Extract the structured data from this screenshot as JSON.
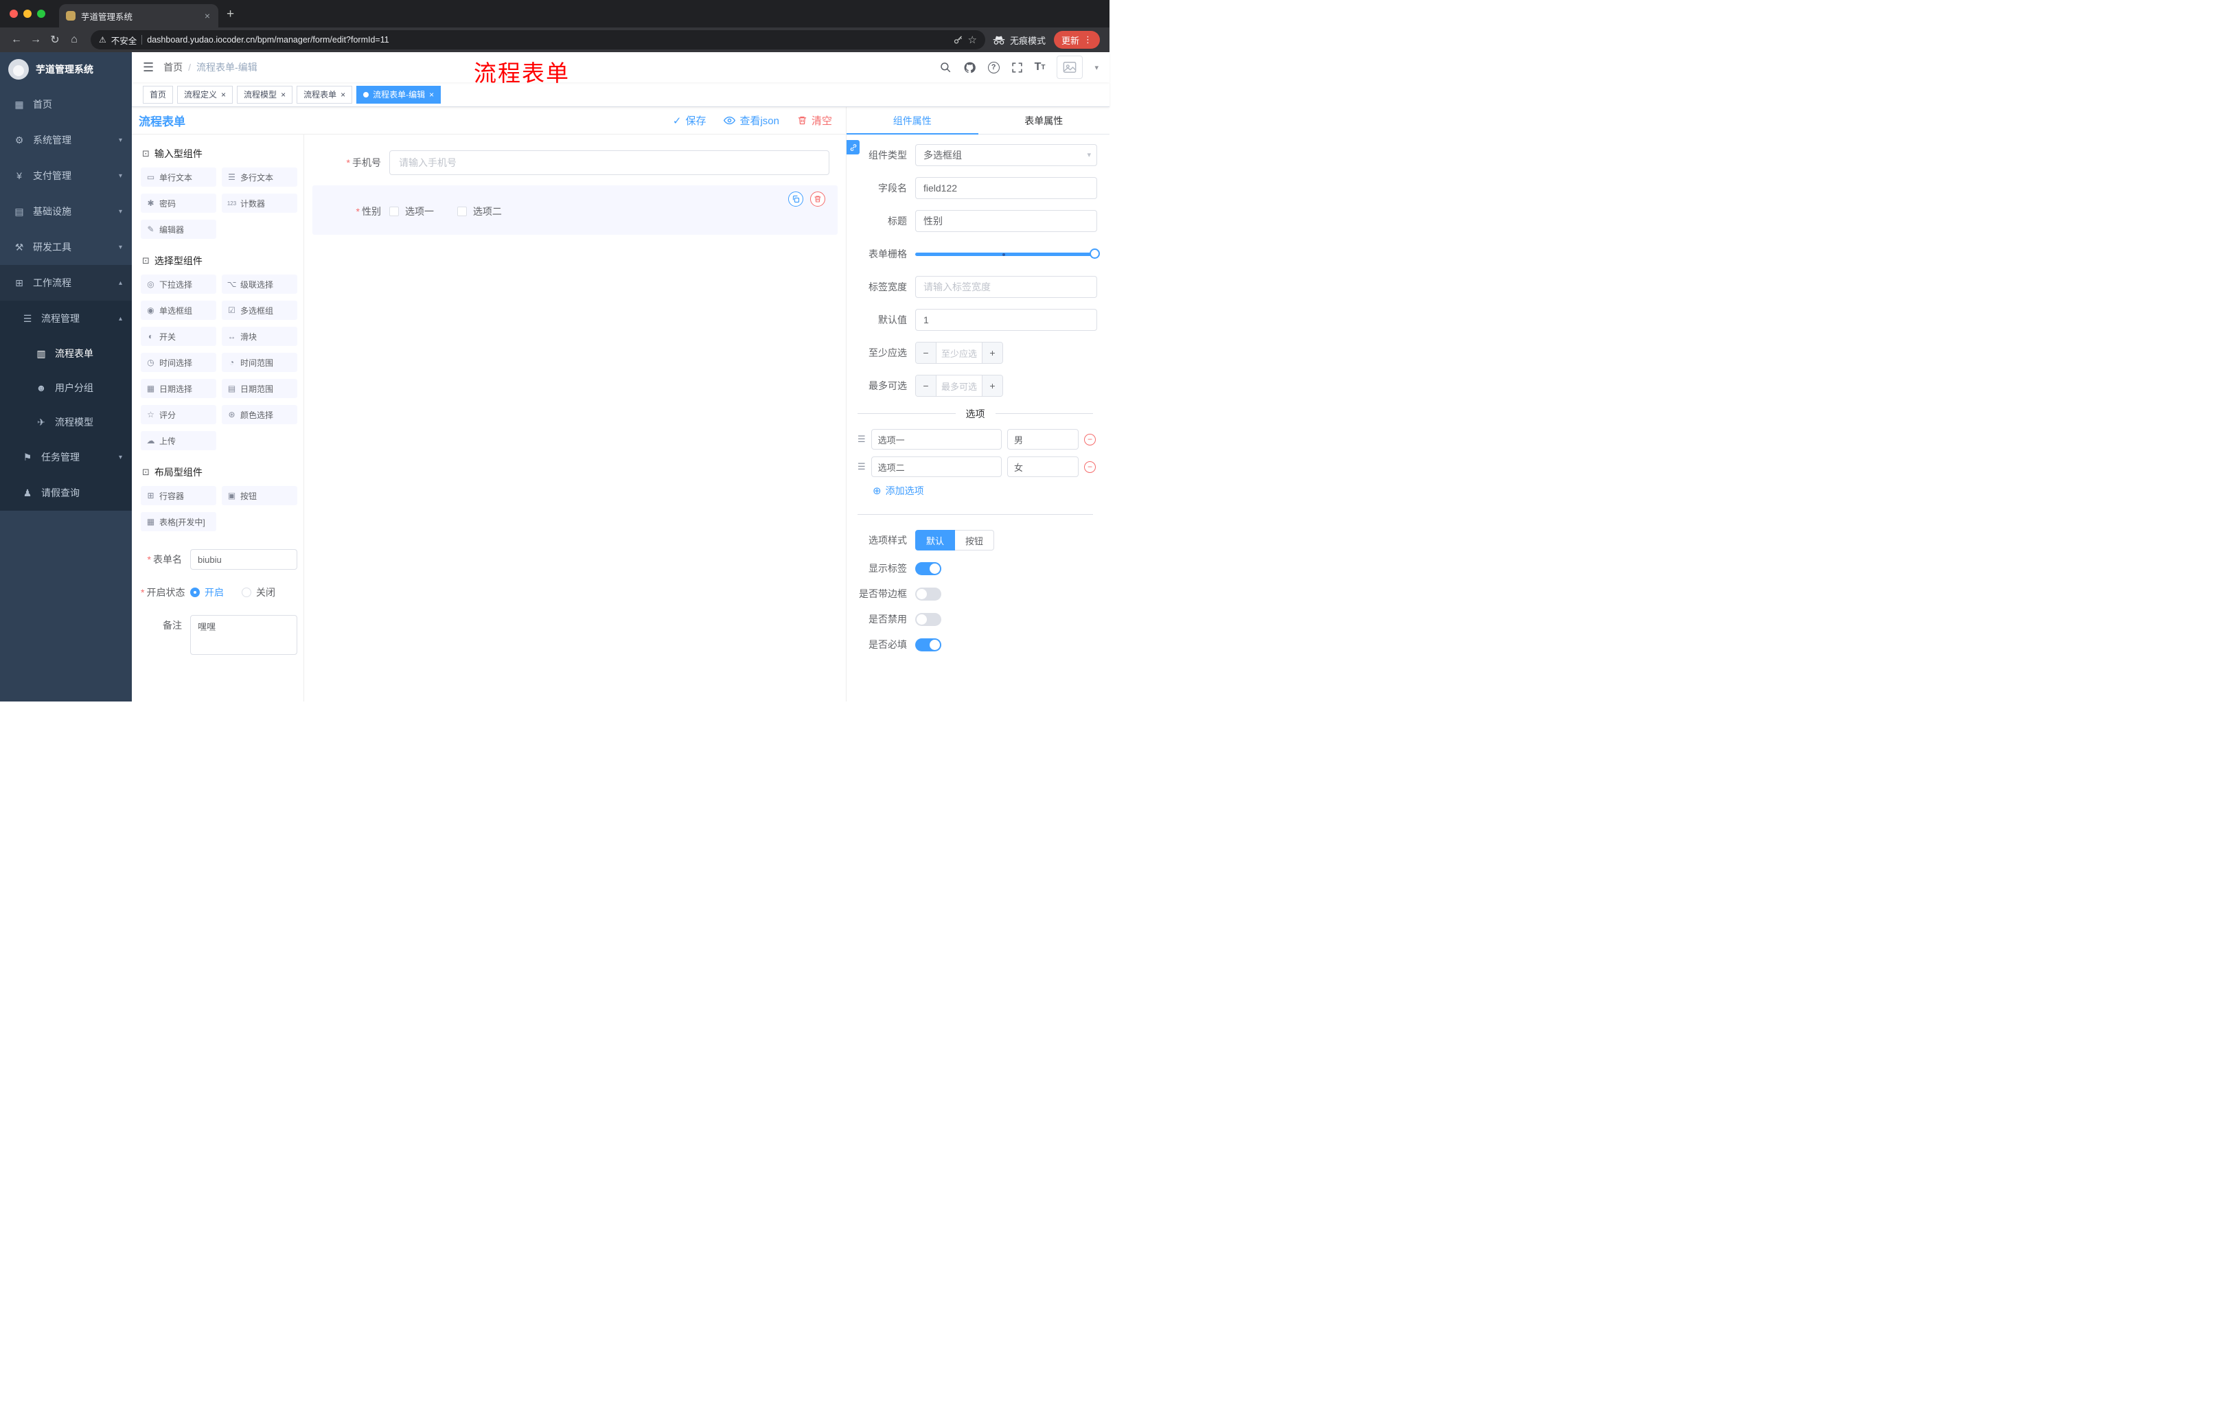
{
  "browser": {
    "tab_title": "芋道管理系统",
    "security_label": "不安全",
    "url": "dashboard.yudao.iocoder.cn/bpm/manager/form/edit?formId=11",
    "incognito_label": "无痕模式",
    "update_label": "更新"
  },
  "sidebar": {
    "logo_title": "芋道管理系统",
    "items": [
      {
        "label": "首页",
        "icon": "dashboard-icon"
      },
      {
        "label": "系统管理",
        "icon": "gear-icon"
      },
      {
        "label": "支付管理",
        "icon": "yen-icon"
      },
      {
        "label": "基础设施",
        "icon": "infrastructure-icon"
      },
      {
        "label": "研发工具",
        "icon": "tools-icon"
      },
      {
        "label": "工作流程",
        "icon": "workflow-icon"
      },
      {
        "label": "流程管理",
        "icon": "process-list-icon"
      },
      {
        "label": "流程表单",
        "icon": "form-doc-icon"
      },
      {
        "label": "用户分组",
        "icon": "user-group-icon"
      },
      {
        "label": "流程模型",
        "icon": "paper-plane-icon"
      },
      {
        "label": "任务管理",
        "icon": "flag-icon"
      },
      {
        "label": "请假查询",
        "icon": "person-icon"
      }
    ]
  },
  "header": {
    "breadcrumb": [
      "首页",
      "流程表单-编辑"
    ],
    "separator": "/",
    "overlay_title": "流程表单"
  },
  "tags": [
    {
      "label": "首页"
    },
    {
      "label": "流程定义"
    },
    {
      "label": "流程模型"
    },
    {
      "label": "流程表单"
    },
    {
      "label": "流程表单-编辑"
    }
  ],
  "builder": {
    "title": "流程表单",
    "actions": {
      "save": "保存",
      "view_json": "查看json",
      "clear": "清空"
    },
    "palette": {
      "sections": [
        {
          "title": "输入型组件",
          "items": [
            {
              "label": "单行文本"
            },
            {
              "label": "多行文本"
            },
            {
              "label": "密码"
            },
            {
              "label": "计数器"
            },
            {
              "label": "编辑器"
            }
          ]
        },
        {
          "title": "选择型组件",
          "items": [
            {
              "label": "下拉选择"
            },
            {
              "label": "级联选择"
            },
            {
              "label": "单选框组"
            },
            {
              "label": "多选框组"
            },
            {
              "label": "开关"
            },
            {
              "label": "滑块"
            },
            {
              "label": "时间选择"
            },
            {
              "label": "时间范围"
            },
            {
              "label": "日期选择"
            },
            {
              "label": "日期范围"
            },
            {
              "label": "评分"
            },
            {
              "label": "颜色选择"
            },
            {
              "label": "上传"
            }
          ]
        },
        {
          "title": "布局型组件",
          "items": [
            {
              "label": "行容器"
            },
            {
              "label": "按钮"
            },
            {
              "label": "表格[开发中]"
            }
          ]
        }
      ]
    },
    "form": {
      "name_label": "表单名",
      "name_value": "biubiu",
      "status_label": "开启状态",
      "status_on": "开启",
      "status_off": "关闭",
      "remark_label": "备注",
      "remark_value": "嘿嘿"
    },
    "canvas": {
      "phone": {
        "label": "手机号",
        "placeholder": "请输入手机号"
      },
      "gender": {
        "label": "性别",
        "options": [
          {
            "label": "选项一"
          },
          {
            "label": "选项二"
          }
        ]
      }
    }
  },
  "inspector": {
    "tabs": [
      {
        "label": "组件属性"
      },
      {
        "label": "表单属性"
      }
    ],
    "component_type": {
      "label": "组件类型",
      "value": "多选框组"
    },
    "field_name": {
      "label": "字段名",
      "value": "field122"
    },
    "title_field": {
      "label": "标题",
      "value": "性别"
    },
    "grid": {
      "label": "表单栅格"
    },
    "label_width": {
      "label": "标签宽度",
      "placeholder": "请输入标签宽度"
    },
    "default_value": {
      "label": "默认值",
      "value": "1"
    },
    "min_select": {
      "label": "至少应选",
      "placeholder": "至少应选"
    },
    "max_select": {
      "label": "最多可选",
      "placeholder": "最多可选"
    },
    "options_title": "选项",
    "options": [
      {
        "label": "选项一",
        "value": "男"
      },
      {
        "label": "选项二",
        "value": "女"
      }
    ],
    "add_option_label": "添加选项",
    "option_style": {
      "label": "选项样式",
      "choices": [
        {
          "label": "默认"
        },
        {
          "label": "按钮"
        }
      ]
    },
    "switches": [
      {
        "label": "显示标签",
        "on": true
      },
      {
        "label": "是否带边框",
        "on": false
      },
      {
        "label": "是否禁用",
        "on": false
      },
      {
        "label": "是否必填",
        "on": true
      }
    ]
  },
  "colors": {
    "primary": "#409EFF",
    "danger": "#F56C6C",
    "sidebar_bg": "#304156"
  }
}
